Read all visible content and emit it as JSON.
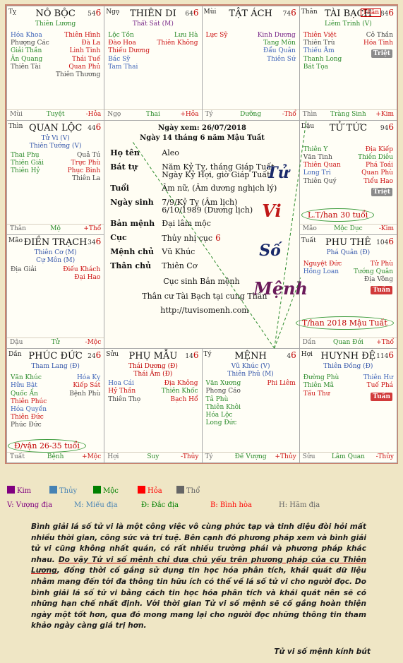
{
  "palaces": [
    {
      "id": "no-boc",
      "can": "Tỵ",
      "name": "NÔ BỘC",
      "num": "54",
      "six": "6",
      "sub": "Thiên Lương",
      "subc": "g",
      "left": [
        [
          "Hóa Khoa",
          "b"
        ],
        [
          "Phượng Các",
          "k"
        ],
        [
          "Giải Thần",
          "g"
        ],
        [
          "Ân Quang",
          "g"
        ],
        [
          "Thiên Tài",
          "k"
        ]
      ],
      "right": [
        [
          "Thiên Hình",
          "r"
        ],
        [
          "Đà La",
          "r"
        ],
        [
          "Linh Tinh",
          "r"
        ],
        [
          "Thái Tuế",
          "r"
        ],
        [
          "Quan Phủ",
          "r"
        ],
        [
          "Thiên Thương",
          "k"
        ]
      ],
      "foot": [
        "Mùi",
        "Tuyệt",
        "-Hỏa"
      ]
    },
    {
      "id": "thien-di",
      "can": "Ngọ",
      "name": "THIÊN DI",
      "num": "64",
      "six": "6",
      "sub": "Thất Sát (M)",
      "subc": "p",
      "left": [
        [
          "Lộc Tồn",
          "g"
        ],
        [
          "Đào Hoa",
          "r"
        ],
        [
          "Thiếu Dương",
          "r"
        ],
        [
          "Bác Sỹ",
          "b"
        ],
        [
          "Tam Thai",
          "b"
        ]
      ],
      "right": [
        [
          "Lưu Hà",
          "g"
        ],
        [
          "Thiên Không",
          "r"
        ]
      ],
      "foot": [
        "Ngọ",
        "Thai",
        "+Hỏa"
      ]
    },
    {
      "id": "tat-ach",
      "can": "Mùi",
      "name": "TẬT ÁCH",
      "num": "74",
      "six": "6",
      "sub": "",
      "subc": "g",
      "left": [
        [
          "Lực Sỹ",
          "r"
        ]
      ],
      "right": [
        [
          "Kinh Dương",
          "p"
        ],
        [
          "Tang Môn",
          "g"
        ],
        [
          "Đẩu Quân",
          "b"
        ],
        [
          "Thiên Sứ",
          "b"
        ]
      ],
      "foot": [
        "Tý",
        "Dưỡng",
        "-Thổ"
      ]
    },
    {
      "id": "tai-bach",
      "can": "Thân",
      "name": "TÀI BẠCH",
      "num": "84",
      "six": "6",
      "sub": "Liêm Trinh (V)",
      "subc": "g",
      "than": "Thân",
      "left": [
        [
          "Thiên Việt",
          "r"
        ],
        [
          "Thiên Trù",
          "k"
        ],
        [
          "Thiếu Âm",
          "b"
        ],
        [
          "Thanh Long",
          "g"
        ],
        [
          "Bát Tọa",
          "g"
        ]
      ],
      "right": [
        [
          "Cô Thần",
          "k"
        ],
        [
          "Hóa Tinh",
          "r"
        ]
      ],
      "badges": [
        [
          "Triệt",
          "grey"
        ]
      ],
      "foot": [
        "Thìn",
        "Tràng Sinh",
        "+Kim"
      ]
    },
    {
      "id": "quan-loc",
      "can": "Thìn",
      "name": "QUAN LỘC",
      "num": "44",
      "six": "6",
      "sub": "Tử Vi (V)",
      "sub2": "Thiên Tướng (V)",
      "subc": "blue",
      "left": [
        [
          "Thai Phụ",
          "g"
        ],
        [
          "Thiên Giải",
          "g"
        ],
        [
          "Thiên Hỷ",
          "g"
        ]
      ],
      "right": [
        [
          "Quả Tú",
          "k"
        ],
        [
          "Trực Phù",
          "r"
        ],
        [
          "Phục Binh",
          "r"
        ],
        [
          "Thiên La",
          "k"
        ]
      ],
      "foot": [
        "Thân",
        "Mộ",
        "+Thổ"
      ]
    },
    {
      "id": "tu-tuc",
      "can": "Dậu",
      "name": "TỬ TỨC",
      "num": "94",
      "six": "6",
      "sub": "",
      "subc": "g",
      "left": [
        [
          "Thiên Y",
          "g"
        ],
        [
          "Văn Tinh",
          "k"
        ],
        [
          "Thiên Quan",
          "r"
        ],
        [
          "Long Trì",
          "b"
        ],
        [
          "Thiên Quý",
          "k"
        ]
      ],
      "right": [
        [
          "Địa Kiếp",
          "r"
        ],
        [
          "Thiên Diêu",
          "g"
        ],
        [
          "Phá Toái",
          "r"
        ],
        [
          "Quan Phù",
          "r"
        ],
        [
          "Tiểu Hao",
          "r"
        ]
      ],
      "badges": [
        [
          "Triệt",
          "grey"
        ]
      ],
      "foot": [
        "Mão",
        "Mộc Dục",
        "-Kim"
      ]
    },
    {
      "id": "dien-trach",
      "can": "Mão",
      "name": "ĐIỀN TRẠCH",
      "num": "34",
      "six": "6",
      "sub": "Thiên Cơ (M)",
      "sub2": "Cự Môn (M)",
      "subc": "blue",
      "left": [
        [
          "Địa Giải",
          "k"
        ]
      ],
      "right": [
        [
          "Điếu Khách",
          "r"
        ],
        [
          "Đại Hao",
          "r"
        ]
      ],
      "foot": [
        "Dậu",
        "Tử",
        "-Mộc"
      ]
    },
    {
      "id": "phu-the",
      "can": "Tuất",
      "name": "PHU THÊ",
      "num": "104",
      "six": "6",
      "sub": "Phá Quân (Đ)",
      "subc": "blue",
      "left": [
        [
          "Nguyệt Đức",
          "r"
        ],
        [
          "Hồng Loan",
          "b"
        ]
      ],
      "right": [
        [
          "Tử Phù",
          "r"
        ],
        [
          "Tướng Quân",
          "g"
        ],
        [
          "Địa Võng",
          "k"
        ]
      ],
      "badges": [
        [
          "Tuần",
          "red"
        ]
      ],
      "foot": [
        "Dần",
        "Quan Đới",
        "+Thổ"
      ]
    },
    {
      "id": "phuc-duc",
      "can": "Dần",
      "name": "PHÚC ĐỨC",
      "num": "24",
      "six": "6",
      "sub": "Tham Lang (Đ)",
      "subc": "blue",
      "left": [
        [
          "Văn Khúc",
          "g"
        ],
        [
          "Hữu Bật",
          "b"
        ],
        [
          "Quốc Ấn",
          "g"
        ],
        [
          "Thiên Phúc",
          "r"
        ],
        [
          "Hóa Quyền",
          "b"
        ],
        [
          "Thiên Đức",
          "r"
        ],
        [
          "Phúc Đức",
          "k"
        ]
      ],
      "right": [
        [
          "Hóa Kỵ",
          "b"
        ],
        [
          "Kiếp Sát",
          "r"
        ],
        [
          "Bệnh Phù",
          "k"
        ]
      ],
      "foot": [
        "Tuất",
        "Bệnh",
        "+Mộc"
      ]
    },
    {
      "id": "phu-mau",
      "can": "Sửu",
      "name": "PHỤ MẪU",
      "num": "14",
      "six": "6",
      "sub": "Thái Dương (Đ)",
      "sub2": "Thái Âm (Đ)",
      "subc": "red",
      "left": [
        [
          "Hoa Cái",
          "b"
        ],
        [
          "Hỷ Thần",
          "r"
        ],
        [
          "Thiên Thọ",
          "k"
        ]
      ],
      "right": [
        [
          "Địa Không",
          "r"
        ],
        [
          "Thiên Khốc",
          "g"
        ],
        [
          "Bạch Hổ",
          "r"
        ]
      ],
      "foot": [
        "Hợi",
        "Suy",
        "-Thủy"
      ]
    },
    {
      "id": "menh",
      "can": "Tý",
      "name": "MỆNH",
      "num": "4",
      "six": "6",
      "sub": "Vũ Khúc (V)",
      "sub2": "Thiên Phủ (M)",
      "subc": "blue",
      "left": [
        [
          "Văn Xương",
          "g"
        ],
        [
          "Phong Cáo",
          "k"
        ],
        [
          "Tả Phù",
          "g"
        ],
        [
          "Thiên Khôi",
          "g"
        ],
        [
          "Hóa Lộc",
          "g"
        ],
        [
          "Long Đức",
          "g"
        ]
      ],
      "right": [
        [
          "Phi Liêm",
          "r"
        ]
      ],
      "foot": [
        "Tý",
        "Đế Vượng",
        "+Thủy"
      ]
    },
    {
      "id": "huynh-de",
      "can": "Hợi",
      "name": "HUYNH ĐỆ",
      "num": "114",
      "six": "6",
      "sub": "Thiên Đồng (Đ)",
      "subc": "blue",
      "left": [
        [
          "Đường Phù",
          "g"
        ],
        [
          "Thiên Mã",
          "g"
        ],
        [
          "Tấu Thư",
          "r"
        ]
      ],
      "right": [
        [
          "Thiên Hư",
          "b"
        ],
        [
          "Tuế Phá",
          "r"
        ]
      ],
      "badges": [
        [
          "Tuần",
          "red"
        ]
      ],
      "foot": [
        "Sửu",
        "Lâm Quan",
        "-Thủy"
      ]
    }
  ],
  "center": {
    "date_line": "Ngày xem: 26/07/2018",
    "lunar_line": "Ngày 14 tháng 6 năm Mậu Tuất",
    "rows": [
      {
        "label": "Họ tên",
        "value": "Aleo"
      },
      {
        "label": "Bát tự",
        "value": "Năm Kỷ Tỵ, tháng Giáp Tuất",
        "value2": "Ngày Kỷ Hợi, giờ Giáp Tuất"
      },
      {
        "label": "Tuổi",
        "value": "Âm nữ, (Âm dương nghịch lý)"
      },
      {
        "label": "Ngày sinh",
        "value": "7/9/Kỷ Tỵ (Âm lịch)",
        "value2": "6/10/1989 (Dương lịch)"
      },
      {
        "label": "Bản mệnh",
        "value": "Đại lâm mộc"
      },
      {
        "label": "Cục",
        "value": "Thủy nhị cục",
        "six": "6"
      },
      {
        "label": "Mệnh chủ",
        "value": "Vũ Khúc"
      },
      {
        "label": "Thân chủ",
        "value": "Thiên Cơ"
      }
    ],
    "note1": "Cục sinh Bản mệnh",
    "note2": "Thân cư Tài Bạch tại cung Thân",
    "url": "http://tuvisomenh.com",
    "logo": [
      "Tử",
      "Vi",
      "Số",
      "Mệnh"
    ]
  },
  "annotations": {
    "lt_han": "L.T/han 30 tuổi",
    "han_2018": "T/han 2018 Mậu Tuất",
    "dai_van": "Đ/vận 26-35 tuổi"
  },
  "legend": {
    "elements": [
      {
        "label": "Kim",
        "color": "#800080"
      },
      {
        "label": "Thủy",
        "color": "#4682b4"
      },
      {
        "label": "Mộc",
        "color": "#008000"
      },
      {
        "label": "Hỏa",
        "color": "#ff0000"
      },
      {
        "label": "Thổ",
        "color": "#666666"
      }
    ],
    "states": [
      {
        "label": "V: Vượng địa",
        "color": "#800080"
      },
      {
        "label": "M: Miếu địa",
        "color": "#4682b4"
      },
      {
        "label": "Đ: Đắc địa",
        "color": "#008000"
      },
      {
        "label": "B: Bình hòa",
        "color": "#ff0000"
      },
      {
        "label": "H: Hãm địa",
        "color": "#666666"
      }
    ]
  },
  "paragraph": {
    "p1": "Bình giải lá số tử vi là một công việc vô cùng phức tạp và tinh diệu đòi hỏi mất nhiều thời gian, công sức và trí tuệ. Bên cạnh đó phương pháp xem và bình giải tử vi cũng không nhất quán, có rất nhiều trường phái và phương pháp khác nhau. ",
    "p2": "Do vậy Tử vi số mệnh chỉ dựa chủ yếu trên phương pháp của cụ Thiên Lương",
    "p3": ", đồng thời cố gắng sử dụng tin học hóa phân tích, khái quát dữ liệu nhằm mang đến tới đa thông tin hữu ích có thể về lá số tử vi cho người đọc. Do bình giải lá số tử vi bằng cách tin học hóa phân tích và khái quát nên sẽ có những hạn chế nhất định. Với thời gian Tử vi số mệnh sẽ cố gắng hoàn thiện ngày một tốt hơn, qua đó mong mang lại cho người đọc những thông tin tham khảo ngày càng giá trị hơn.",
    "signature": "Tử vi số mệnh kính bút"
  }
}
